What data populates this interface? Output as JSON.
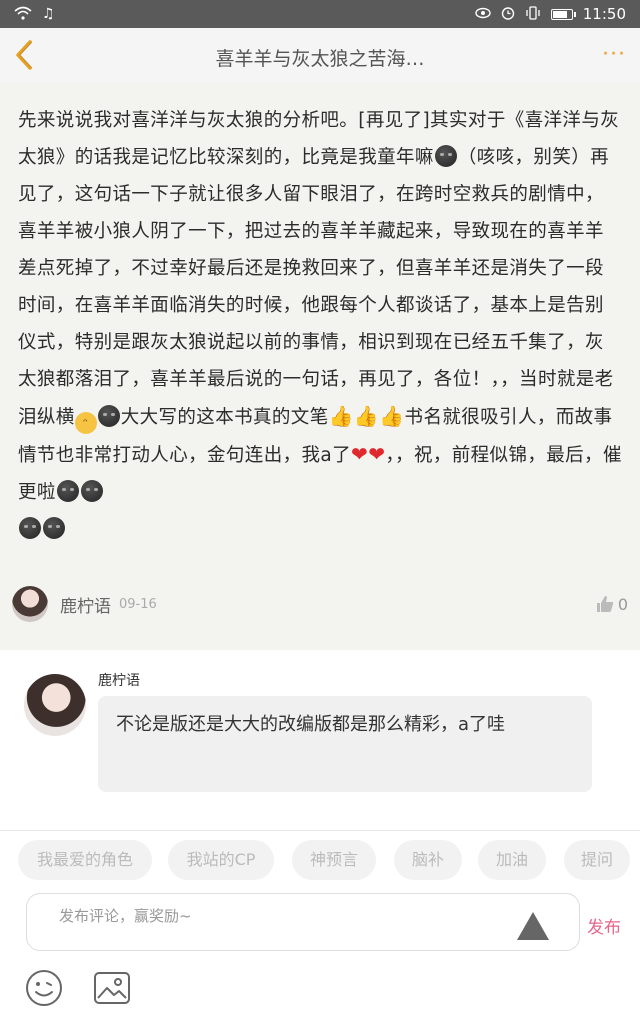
{
  "status_bar": {
    "time": "11:50"
  },
  "header": {
    "title": "喜羊羊与灰太狼之苦海…",
    "more": "···"
  },
  "post": {
    "body_segments": [
      "先来说说我对喜洋洋与灰太狼的分析吧。[再见了]其实对于《喜洋洋与灰太狼》的话我是记忆比较深刻的，比竟是我童年嘛",
      "（咳咳，别笑）再见了，这句话一下子就让很多人留下眼泪了，在跨时空救兵的剧情中，喜羊羊被小狼人阴了一下，把过去的喜羊羊藏起来，导致现在的喜羊羊差点死掉了，不过幸好最后还是挽救回来了，但喜羊羊还是消失了一段时间，在喜羊羊面临消失的时候，他跟每个人都谈话了，基本上是告别仪式，特别是跟灰太狼说起以前的事情，相识到现在已经五千集了，灰太狼都落泪了，喜羊羊最后说的一句话，再见了，各位！，，当时就是老泪纵横",
      "大大写的这本书真的文笔",
      "书名就很吸引人，而故事情节也非常打动人心，金句连出，我a了",
      "，，祝，前程似锦，最后，催更啦"
    ],
    "author": "鹿柠语",
    "date": "09-16",
    "likes": "0"
  },
  "reply": {
    "author": "鹿柠语",
    "text": "不论是版还是大大的改编版都是那么精彩，a了哇"
  },
  "tags": [
    "我最爱的角色",
    "我站的CP",
    "神预言",
    "脑补",
    "加油",
    "提问"
  ],
  "composer": {
    "placeholder": "发布评论，赢奖励~",
    "send_label": "发布"
  },
  "icons": {
    "wifi": "wifi-icon",
    "music": "music-icon",
    "eye": "eye-icon",
    "alarm": "alarm-icon",
    "vibrate": "vibrate-icon",
    "battery": "battery-icon",
    "back": "back-chevron-icon",
    "like": "thumbs-up-icon",
    "emoji": "smiley-icon",
    "image": "image-icon"
  },
  "colors": {
    "accent": "#f0a030",
    "send": "#e6678e",
    "post_bg": "#f3f3ef"
  }
}
